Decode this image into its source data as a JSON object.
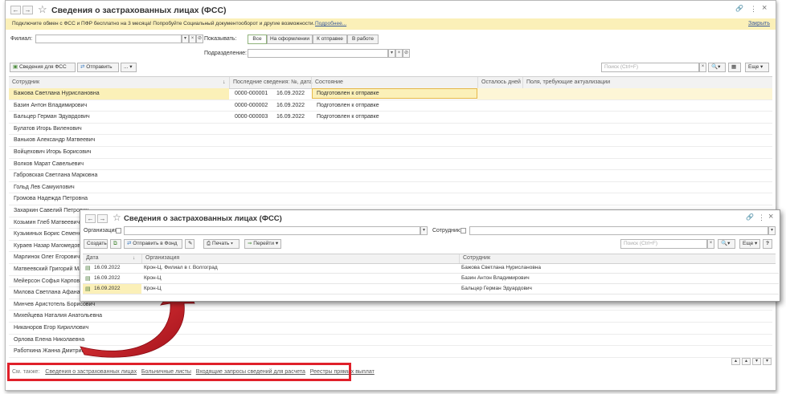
{
  "window": {
    "title": "Сведения о застрахованных лицах (ФСС)",
    "nav_back": "←",
    "nav_forward": "→",
    "star": "☆",
    "link_icon": "🔗",
    "menu_icon": "⋮",
    "close_icon": "×"
  },
  "banner": {
    "text": "Подключите обмен с ФСС и ПФР бесплатно на 3 месяца! Попробуйте Социальный документооборот и другие возможности.",
    "more_link": "Подробнее...",
    "close_link": "Закрыть"
  },
  "filters": {
    "branch_label": "Филиал:",
    "branch_value": "",
    "show_label": "Показывать:",
    "show_options": [
      "Все",
      "На оформлении",
      "К отправке",
      "В работе"
    ],
    "subdivision_label": "Подразделение:",
    "subdivision_value": ""
  },
  "toolbar": {
    "create_label": "Сведения для ФСС",
    "send_label": "Отправить",
    "more_dots": "...",
    "search_placeholder": "Поиск (Ctrl+F)",
    "more_label": "Еще"
  },
  "table": {
    "columns": [
      "Сотрудник",
      "Последние сведения: №, дата",
      "Состояние",
      "Осталось дней",
      "Поля, требующие актуализации"
    ],
    "sort_indicator": "↓",
    "rows": [
      {
        "employee": "Бажова Светлана Нурислановна",
        "number": "0000-000001",
        "date": "16.09.2022",
        "status": "Подготовлен к отправке"
      },
      {
        "employee": "Базин Антон Владимирович",
        "number": "0000-000002",
        "date": "16.09.2022",
        "status": "Подготовлен к отправке"
      },
      {
        "employee": "Бальцер Герман Эдуардович",
        "number": "0000-000003",
        "date": "16.09.2022",
        "status": "Подготовлен к отправке"
      },
      {
        "employee": "Булатов Игорь Виленович",
        "number": "",
        "date": "",
        "status": ""
      },
      {
        "employee": "Ваньков Александр Матвеевич",
        "number": "",
        "date": "",
        "status": ""
      },
      {
        "employee": "Войцехович Игорь Борисович",
        "number": "",
        "date": "",
        "status": ""
      },
      {
        "employee": "Волков Марат Савельевич",
        "number": "",
        "date": "",
        "status": ""
      },
      {
        "employee": "Габровская Светлана Марковна",
        "number": "",
        "date": "",
        "status": ""
      },
      {
        "employee": "Гольд Лев Самуилович",
        "number": "",
        "date": "",
        "status": ""
      },
      {
        "employee": "Громова Надежда Петровна",
        "number": "",
        "date": "",
        "status": ""
      },
      {
        "employee": "Захаркин Савелий Петрович",
        "number": "",
        "date": "",
        "status": ""
      },
      {
        "employee": "Козьмин Глеб Матвеевич",
        "number": "",
        "date": "",
        "status": ""
      },
      {
        "employee": "Кузьминых Борис Семенович",
        "number": "",
        "date": "",
        "status": ""
      },
      {
        "employee": "Кураев Назар Магомедович",
        "number": "",
        "date": "",
        "status": ""
      },
      {
        "employee": "Марлинок Олег Егорович",
        "number": "",
        "date": "",
        "status": ""
      },
      {
        "employee": "Матвеевский Григорий Матвеевич",
        "number": "",
        "date": "",
        "status": ""
      },
      {
        "employee": "Мейерсон Софья Карповна",
        "number": "",
        "date": "",
        "status": ""
      },
      {
        "employee": "Милова Светлана Афанасьевна",
        "number": "",
        "date": "",
        "status": ""
      },
      {
        "employee": "Минчев Аристотель Борисович",
        "number": "",
        "date": "",
        "status": ""
      },
      {
        "employee": "Михейцева Наталия Анатольевна",
        "number": "",
        "date": "",
        "status": ""
      },
      {
        "employee": "Никаноров Егор Кириллович",
        "number": "",
        "date": "",
        "status": ""
      },
      {
        "employee": "Орлова Елена Николаевна",
        "number": "",
        "date": "",
        "status": ""
      },
      {
        "employee": "Работкина Жанна Дмитриевна",
        "number": "",
        "date": "",
        "status": ""
      }
    ]
  },
  "see_also": {
    "label": "См. также:",
    "links": [
      "Сведения о застрахованных лицах",
      "Больничные листы",
      "Входящие запросы сведений для расчета",
      "Реестры прямых выплат"
    ]
  },
  "subwindow": {
    "title": "Сведения о застрахованных лицах (ФСС)",
    "org_label": "Организация:",
    "employee_label": "Сотрудник:",
    "create_label": "Создать",
    "send_fund_label": "Отправить в Фонд",
    "print_label": "Печать",
    "goto_label": "Перейти",
    "search_placeholder": "Поиск (Ctrl+F)",
    "more_label": "Еще",
    "help_label": "?",
    "columns": [
      "Дата",
      "Организация",
      "Сотрудник"
    ],
    "rows": [
      {
        "date": "16.09.2022",
        "org": "Крон-Ц. Филиал в г. Волгоград",
        "employee": "Бажова Светлана Нурислановна"
      },
      {
        "date": "16.09.2022",
        "org": "Крон-Ц",
        "employee": "Базин Антон Владимирович"
      },
      {
        "date": "16.09.2022",
        "org": "Крон-Ц",
        "employee": "Бальцер Герман Эдуардович"
      }
    ]
  },
  "colors": {
    "highlight": "#fbf0b8",
    "annotation_red": "#e0202a",
    "active_filter": "#8fb27a"
  }
}
